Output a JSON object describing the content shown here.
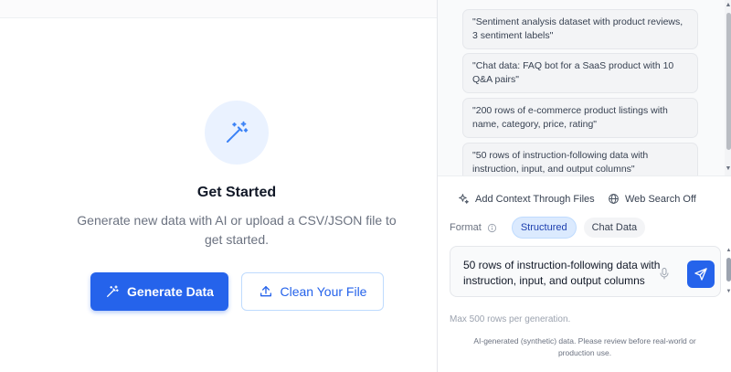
{
  "main": {
    "title": "Get Started",
    "subtitle": "Generate new data with AI or upload a CSV/JSON file to get started.",
    "generate_label": "Generate Data",
    "clean_label": "Clean Your File",
    "accent": "#2563eb"
  },
  "panel": {
    "suggestions": [
      "\"Sentiment analysis dataset with product reviews, 3 sentiment labels\"",
      "\"Chat data: FAQ bot for a SaaS product with 10 Q&A pairs\"",
      "\"200 rows of e-commerce product listings with name, category, price, rating\"",
      "\"50 rows of instruction-following data with instruction, input, and output columns\""
    ],
    "add_context_label": "Add Context Through Files",
    "web_search_label": "Web Search Off",
    "format_label": "Format",
    "format_options": [
      "Structured",
      "Chat Data"
    ],
    "format_selected": "Structured",
    "prompt_value": "50 rows of instruction-following data with instruction, input, and output columns",
    "limit_text": "Max 500 rows per generation.",
    "disclaimer": "AI-generated (synthetic) data. Please review before real-world or production use."
  },
  "icons": {
    "hero": "magic-wand-icon",
    "generate": "magic-wand-icon",
    "clean": "upload-icon",
    "add_context": "sparkle-icon",
    "web_search": "globe-icon",
    "format_info": "info-icon",
    "mic": "microphone-icon",
    "send": "send-icon"
  }
}
